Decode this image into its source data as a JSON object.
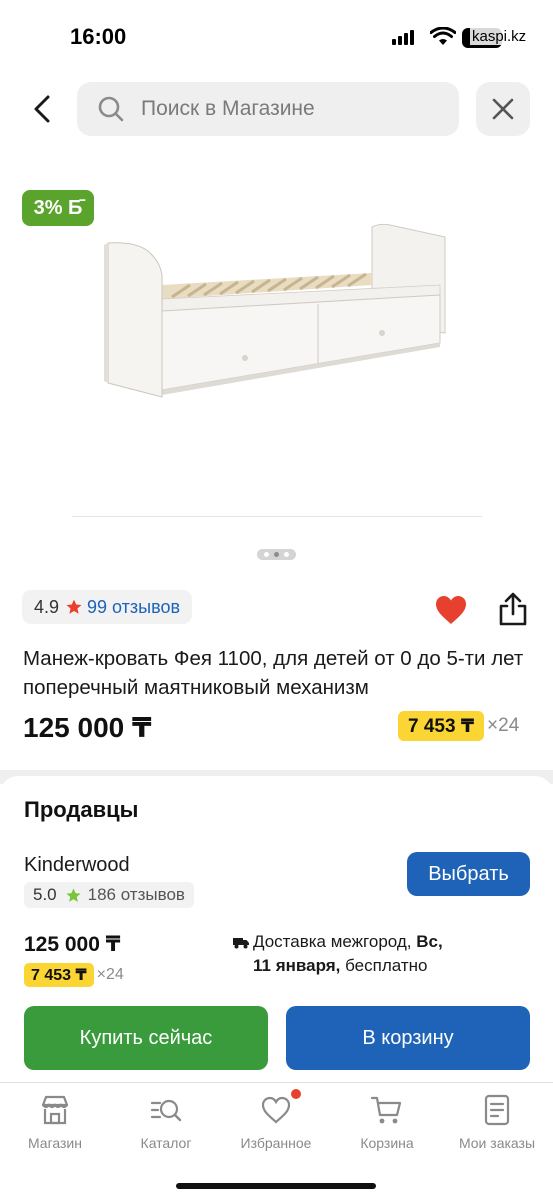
{
  "status_bar": {
    "time": "16:00",
    "watermark": "kaspi.kz"
  },
  "search": {
    "placeholder": "Поиск в Магазине"
  },
  "product": {
    "bonus_badge": "3% Б̄",
    "rating": "4.9",
    "reviews_link": "99 отзывов",
    "title": "Манеж-кровать Фея 1100, для детей от 0 до 5-ти лет поперечный маятниковый механизм",
    "price": "125 000 ₸",
    "installment_amount": "7 453 ₸",
    "installment_months": "×24",
    "image_count": 3,
    "image_active": 1
  },
  "sellers": {
    "title": "Продавцы",
    "seller": {
      "name": "Kinderwood",
      "rating": "5.0",
      "reviews": "186 отзывов",
      "choose_label": "Выбрать",
      "price": "125 000 ₸",
      "installment_amount": "7 453 ₸",
      "installment_months": "×24",
      "delivery_prefix": "Доставка межгород,",
      "delivery_day": "Вс,",
      "delivery_date": "11 января,",
      "delivery_cost": "бесплатно"
    }
  },
  "actions": {
    "buy_now": "Купить сейчас",
    "to_cart": "В корзину"
  },
  "tabbar": {
    "items": [
      {
        "label": "Магазин",
        "icon": "shop-icon"
      },
      {
        "label": "Каталог",
        "icon": "catalog-search-icon"
      },
      {
        "label": "Избранное",
        "icon": "heart-icon"
      },
      {
        "label": "Корзина",
        "icon": "cart-icon"
      },
      {
        "label": "Мои заказы",
        "icon": "orders-icon"
      }
    ]
  },
  "colors": {
    "accent_blue": "#1f63b8",
    "buy_green": "#3a9b3d",
    "bonus_green": "#5aa32c",
    "installment_yellow": "#fbd533",
    "favorite_red": "#e8402e"
  }
}
